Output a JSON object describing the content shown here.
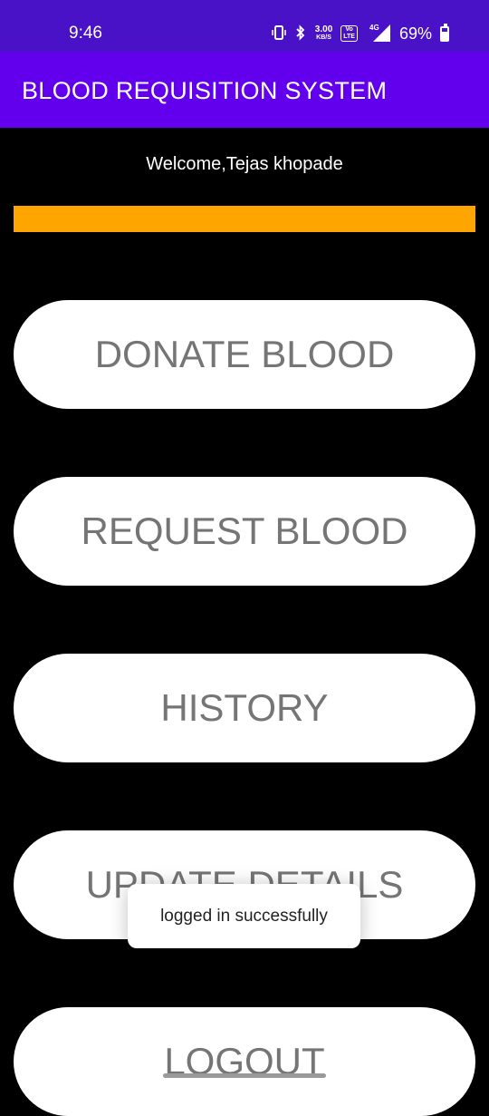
{
  "status_bar": {
    "time": "9:46",
    "network_speed": "3.00",
    "network_speed_unit": "KB/S",
    "volte_label": "VoLTE",
    "signal_label": "4G",
    "battery_percent": "69%",
    "battery_level": 0.69,
    "icons": [
      "vibrate-icon",
      "bluetooth-icon",
      "volte-icon",
      "signal-icon",
      "battery-icon"
    ]
  },
  "app_bar": {
    "title": "BLOOD REQUISITION SYSTEM",
    "color": "#6200ee"
  },
  "welcome": {
    "text": "Welcome,Tejas khopade"
  },
  "progress": {
    "value": 1.0,
    "color": "#ffa500"
  },
  "buttons": {
    "donate": "DONATE BLOOD",
    "request": "REQUEST BLOOD",
    "history": "HISTORY",
    "update": "UPDATE DETAILS",
    "logout": "LOGOUT"
  },
  "toast": {
    "text": "logged in successfully"
  }
}
